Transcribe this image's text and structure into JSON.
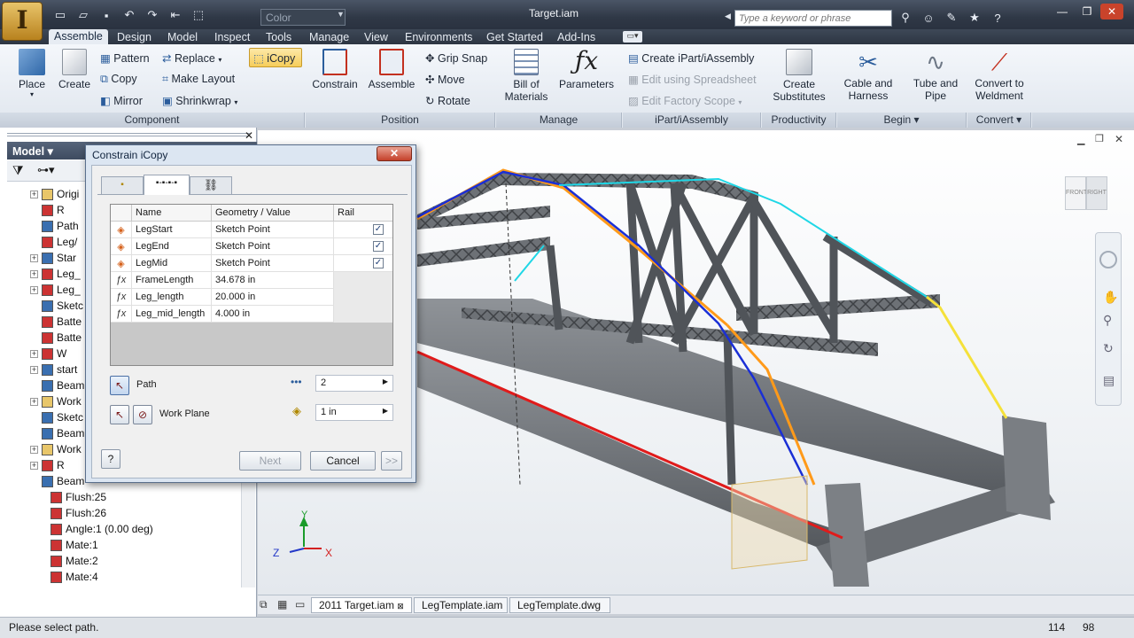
{
  "app": {
    "title": "Target.iam",
    "color_field": "Color",
    "search_placeholder": "Type a keyword or phrase",
    "menu_tabs": [
      "Assemble",
      "Design",
      "Model",
      "Inspect",
      "Tools",
      "Manage",
      "View",
      "Environments",
      "Get Started",
      "Add-Ins"
    ]
  },
  "ribbon": {
    "component": {
      "place": "Place",
      "create": "Create",
      "pattern": "Pattern",
      "copy": "Copy",
      "mirror": "Mirror",
      "replace": "Replace",
      "make_layout": "Make Layout",
      "shrinkwrap": "Shrinkwrap",
      "icopy": "iCopy",
      "panel": "Component"
    },
    "position": {
      "constrain": "Constrain",
      "assemble": "Assemble",
      "grip_snap": "Grip Snap",
      "move": "Move",
      "rotate": "Rotate",
      "panel": "Position"
    },
    "manage": {
      "bill1": "Bill of",
      "bill2": "Materials",
      "parameters": "Parameters",
      "panel": "Manage"
    },
    "ipart": {
      "create": "Create iPart/iAssembly",
      "edit_spreadsheet": "Edit using Spreadsheet",
      "edit_factory": "Edit Factory Scope",
      "panel": "iPart/iAssembly"
    },
    "productivity": {
      "create1": "Create",
      "create2": "Substitutes",
      "panel": "Productivity"
    },
    "begin": {
      "cable1": "Cable and",
      "cable2": "Harness",
      "tube1": "Tube and",
      "tube2": "Pipe",
      "panel": "Begin"
    },
    "convert": {
      "conv1": "Convert to",
      "conv2": "Weldment",
      "panel": "Convert"
    }
  },
  "browser": {
    "title": "Model",
    "items": [
      "Origi",
      "R",
      "Path",
      "Leg/",
      "Star",
      "Leg_",
      "Leg_",
      "Sketc",
      "Batte",
      "Batte",
      "W",
      "start",
      "Beam",
      "Work",
      "Sketc",
      "Beam",
      "Work",
      "R",
      "Beam",
      "Flush:25",
      "Flush:26",
      "Angle:1 (0.00 deg)",
      "Mate:1",
      "Mate:2",
      "Mate:4"
    ]
  },
  "dialog": {
    "title": "Constrain iCopy",
    "headers": {
      "name": "Name",
      "geometry": "Geometry / Value",
      "rail": "Rail"
    },
    "rows": [
      {
        "name": "LegStart",
        "value": "Sketch Point",
        "rail": "✓"
      },
      {
        "name": "LegEnd",
        "value": "Sketch Point",
        "rail": "✓"
      },
      {
        "name": "LegMid",
        "value": "Sketch Point",
        "rail": "✓"
      },
      {
        "name": "FrameLength",
        "value": "34.678 in",
        "rail": ""
      },
      {
        "name": "Leg_length",
        "value": "20.000 in",
        "rail": ""
      },
      {
        "name": "Leg_mid_length",
        "value": "4.000 in",
        "rail": ""
      }
    ],
    "path_label": "Path",
    "path_count": "2",
    "workplane_label": "Work Plane",
    "spacing": "1 in",
    "help": "?",
    "next": "Next",
    "cancel": "Cancel",
    "more": ">>"
  },
  "viewcube": {
    "left": "FRONT",
    "right": "RIGHT"
  },
  "doc_tabs": [
    "2011 Target.iam",
    "LegTemplate.iam",
    "LegTemplate.dwg"
  ],
  "status": {
    "message": "Please select path.",
    "n1": "114",
    "n2": "98"
  },
  "triad": {
    "x": "X",
    "y": "Y",
    "z": "Z"
  }
}
